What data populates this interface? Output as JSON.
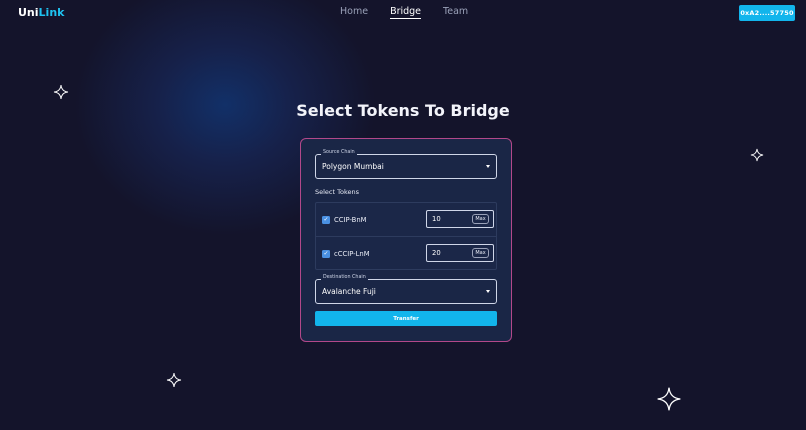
{
  "app": {
    "logo_main": "Uni",
    "logo_accent": "Link",
    "brand_color": "#1ec2f0"
  },
  "nav": {
    "items": [
      {
        "label": "Home"
      },
      {
        "label": "Bridge"
      },
      {
        "label": "Team"
      }
    ],
    "active": "Bridge"
  },
  "wallet": {
    "label": "0xA2....57750"
  },
  "page": {
    "title": "Select Tokens To Bridge"
  },
  "form": {
    "source_chain": {
      "legend": "Source Chain",
      "value": "Polygon Mumbai"
    },
    "select_tokens_label": "Select Tokens",
    "tokens": [
      {
        "name": "CCIP-BnM",
        "checked": true,
        "amount": "10",
        "max_label": "Max"
      },
      {
        "name": "cCCIP-LnM",
        "checked": true,
        "amount": "20",
        "max_label": "Max"
      }
    ],
    "destination_chain": {
      "legend": "Destination Chain",
      "value": "Avalanche Fuji"
    },
    "submit_label": "Transfer"
  },
  "colors": {
    "background": "#14142b",
    "card_border": "#b2488a",
    "button": "#12b5ec"
  }
}
